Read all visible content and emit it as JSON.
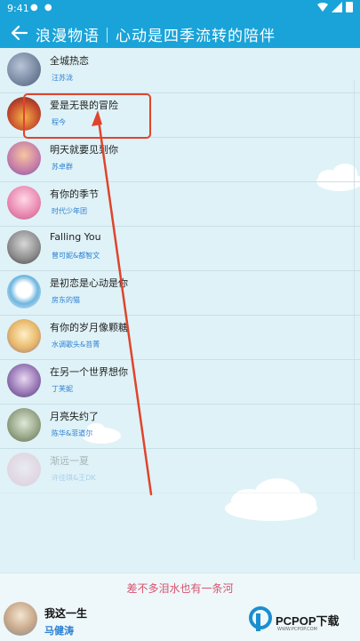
{
  "status_bar": {
    "time": "9:41",
    "dots": "● ●"
  },
  "app_bar": {
    "title": "浪漫物语｜心动是四季流转的陪伴"
  },
  "colors": {
    "accent": "#1aa3d8",
    "artist": "#2a7fd4",
    "lyric": "#d9536f",
    "annotation": "#e0442c"
  },
  "songs": [
    {
      "title": "全城热恋",
      "artist": "汪苏泷"
    },
    {
      "title": "爱是无畏的冒险",
      "artist": "程今"
    },
    {
      "title": "明天就要见到你",
      "artist": "苏卓群"
    },
    {
      "title": "有你的季节",
      "artist": "时代少年团"
    },
    {
      "title": "Falling You",
      "artist": "曾可妮&都智文"
    },
    {
      "title": "是初恋是心动是你",
      "artist": "房东的猫"
    },
    {
      "title": "有你的岁月像颗糖",
      "artist": "水调歌头&苔菁"
    },
    {
      "title": "在另一个世界想你",
      "artist": "丁芙妮"
    },
    {
      "title": "月亮失约了",
      "artist": "陈华&菲道尔"
    },
    {
      "title": "渐远一夏",
      "artist": "许佳琪&王DK"
    }
  ],
  "player": {
    "lyric": "差不多泪水也有一条河",
    "title": "我这一生",
    "artist": "马健涛"
  },
  "watermark": {
    "brand": "PCPOP下载",
    "sub": "WWW.PCPOP.COM"
  }
}
